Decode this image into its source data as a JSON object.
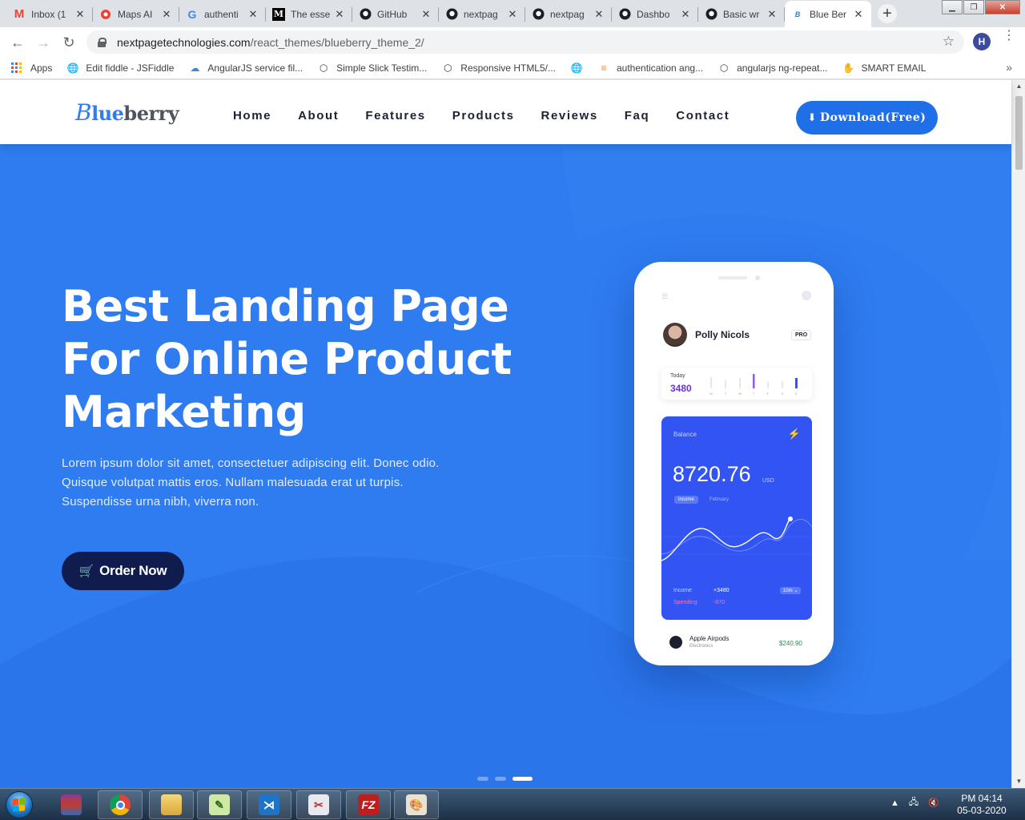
{
  "browser": {
    "tabs": [
      {
        "title": "Inbox (1",
        "icon": "gmail-icon"
      },
      {
        "title": "Maps AI",
        "icon": "maps-icon"
      },
      {
        "title": "authenti",
        "icon": "google-icon"
      },
      {
        "title": "The esse",
        "icon": "medium-icon"
      },
      {
        "title": "GitHub",
        "icon": "github-icon"
      },
      {
        "title": "nextpag",
        "icon": "github-icon"
      },
      {
        "title": "nextpag",
        "icon": "github-icon"
      },
      {
        "title": "Dashbo",
        "icon": "github-icon"
      },
      {
        "title": "Basic wr",
        "icon": "github-icon"
      },
      {
        "title": "Blue Ber",
        "icon": "blueberry-icon",
        "active": true
      }
    ],
    "url_host": "nextpagetechnologies.com",
    "url_path": "/react_themes/blueberry_theme_2/",
    "profile_initial": "H",
    "bookmarks": [
      {
        "label": "Apps"
      },
      {
        "label": "Edit fiddle - JSFiddle"
      },
      {
        "label": "AngularJS service fil..."
      },
      {
        "label": "Simple Slick Testim..."
      },
      {
        "label": "Responsive HTML5/..."
      },
      {
        "label": ""
      },
      {
        "label": "authentication ang..."
      },
      {
        "label": "angularjs ng-repeat..."
      },
      {
        "label": "SMART EMAIL"
      }
    ]
  },
  "site": {
    "logo_b": "B",
    "logo_lue": "lue",
    "logo_berry": "berry",
    "nav": [
      "Home",
      "About",
      "Features",
      "Products",
      "Reviews",
      "Faq",
      "Contact"
    ],
    "download_label": "Download(Free)",
    "headline_l1": "Best Landing Page",
    "headline_l2": "For Online Product",
    "headline_l3": "Marketing",
    "lead_l1": "Lorem ipsum dolor sit amet, consectetuer adipiscing elit. Donec odio.",
    "lead_l2": "Quisque volutpat mattis eros. Nullam malesuada erat ut turpis.",
    "lead_l3": "Suspendisse urna nibh, viverra non.",
    "order_label": "Order Now",
    "colors": {
      "hero": "#2e7cf0",
      "order_button": "#0f1c4d",
      "download_button": "#1f6fe8"
    }
  },
  "phone": {
    "user_name": "Polly Nicols",
    "badge": "PRO",
    "today_label": "Today",
    "today_value": "3480",
    "week_days": [
      "M",
      "T",
      "W",
      "T",
      "F",
      "S",
      "S"
    ],
    "balance_label": "Balance",
    "balance_amount": "8720.76",
    "currency": "USD",
    "chip_income": "Income",
    "chip_month": "February",
    "income_label": "Income",
    "income_value": "+3480",
    "spending_label": "Spending",
    "spending_value": "-670",
    "period": "10m ⌄",
    "item_name": "Apple Airpods",
    "item_category": "Electronics",
    "item_price": "$240.90"
  },
  "taskbar": {
    "time": "PM 04:14",
    "date": "05-03-2020"
  }
}
